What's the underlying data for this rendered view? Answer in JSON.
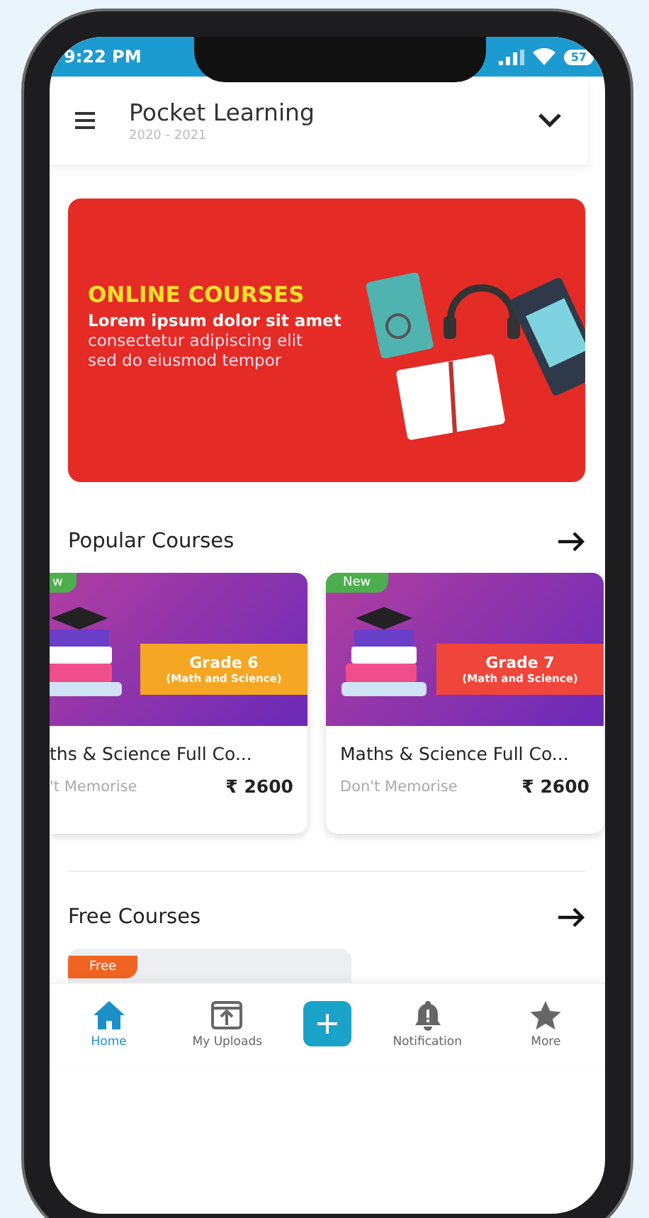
{
  "status_bar": {
    "time": "9:22 PM",
    "battery": "57"
  },
  "header": {
    "title": "Pocket Learning",
    "subtitle": "2020 - 2021"
  },
  "banner": {
    "headline": "ONLINE COURSES",
    "line_1": "Lorem ipsum dolor sit amet",
    "line_2": "consectetur adipiscing elit",
    "line_3": "sed do eiusmod tempor"
  },
  "popular_courses": {
    "title": "Popular Courses",
    "courses": [
      {
        "badge": "w",
        "grade": "Grade 6",
        "subject": "(Math and Science)",
        "color": "#f5a623",
        "title": "ths & Science Full Co...",
        "subtitle": "'t Memorise",
        "price": "₹ 2600"
      },
      {
        "badge": "New",
        "grade": "Grade 7",
        "subject": "(Math and Science)",
        "color": "#f0453a",
        "title": "Maths & Science Full Co...",
        "subtitle": "Don't Memorise",
        "price": "₹ 2600"
      }
    ]
  },
  "free_courses": {
    "title": "Free Courses",
    "courses": [
      {
        "badge": "Free"
      }
    ]
  },
  "bottom_nav": [
    {
      "label": "Home",
      "kind": "tab",
      "selected": true
    },
    {
      "label": "My Uploads",
      "kind": "tab",
      "selected": false
    },
    {
      "kind": "action",
      "selected": false
    },
    {
      "label": "Notification",
      "kind": "tab",
      "selected": false
    },
    {
      "label": "More",
      "kind": "tab",
      "selected": false
    }
  ]
}
